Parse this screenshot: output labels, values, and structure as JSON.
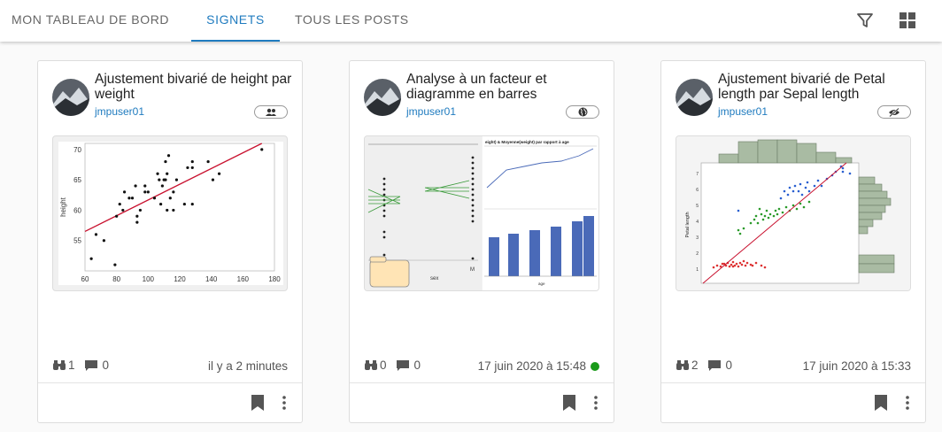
{
  "tabs": [
    {
      "label": "MON TABLEAU DE BORD"
    },
    {
      "label": "SIGNETS"
    },
    {
      "label": "TOUS LES POSTS"
    }
  ],
  "toolbar": {
    "filter_icon": "filter-icon",
    "grid_icon": "grid-view-icon"
  },
  "accent": "#1f7bbf",
  "cards": [
    {
      "title": "Ajustement bivarié de height par weight",
      "user": "jmpuser01",
      "visibility_icon": "group-icon",
      "views": "1",
      "comments": "0",
      "date": "il y a 2 minutes",
      "status_dot": false
    },
    {
      "title": "Analyse à un facteur et diagramme en barres",
      "user": "jmpuser01",
      "visibility_icon": "globe-icon",
      "views": "0",
      "comments": "0",
      "date": "17 juin 2020 à 15:48",
      "status_dot": true,
      "status_color": "#1a9a1a",
      "thumb_texts": {
        "sex_label": "sex",
        "m_label": "M",
        "age_label": "age",
        "chart_title": "eight) & Moyenne(weight) par rapport à age"
      }
    },
    {
      "title": "Ajustement bivarié de Petal length par Sepal length",
      "user": "jmpuser01",
      "visibility_icon": "eye-off-icon",
      "views": "2",
      "comments": "0",
      "date": "17 juin 2020 à 15:33",
      "status_dot": false,
      "thumb_texts": {
        "ylabel": "Petal length",
        "yticks": [
          "1",
          "2",
          "3",
          "4",
          "5",
          "6",
          "7"
        ]
      }
    }
  ],
  "chart_data": {
    "type": "scatter",
    "xlabel": "",
    "ylabel": "height",
    "xlim": [
      60,
      180
    ],
    "ylim": [
      50,
      71
    ],
    "xticks": [
      60,
      80,
      100,
      120,
      140,
      160,
      180
    ],
    "yticks": [
      55,
      60,
      65,
      70
    ],
    "points": [
      [
        64,
        52
      ],
      [
        67,
        56
      ],
      [
        72,
        55
      ],
      [
        79,
        51
      ],
      [
        80,
        59
      ],
      [
        82,
        61
      ],
      [
        84,
        60
      ],
      [
        85,
        63
      ],
      [
        88,
        62
      ],
      [
        90,
        62
      ],
      [
        92,
        64
      ],
      [
        93,
        59
      ],
      [
        93,
        58
      ],
      [
        95,
        60
      ],
      [
        98,
        63
      ],
      [
        98,
        64
      ],
      [
        100,
        63
      ],
      [
        104,
        62
      ],
      [
        106,
        66
      ],
      [
        107,
        65
      ],
      [
        108,
        61
      ],
      [
        109,
        64
      ],
      [
        110,
        65
      ],
      [
        111,
        68
      ],
      [
        111,
        65
      ],
      [
        112,
        66
      ],
      [
        112,
        60
      ],
      [
        113,
        69
      ],
      [
        114,
        62
      ],
      [
        116,
        60
      ],
      [
        116,
        63
      ],
      [
        118,
        65
      ],
      [
        123,
        61
      ],
      [
        125,
        67
      ],
      [
        128,
        61
      ],
      [
        128,
        67
      ],
      [
        128,
        68
      ],
      [
        138,
        68
      ],
      [
        141,
        65
      ],
      [
        145,
        66
      ],
      [
        172,
        70
      ]
    ],
    "fit_line": [
      [
        60,
        56.5
      ],
      [
        172,
        71
      ]
    ]
  }
}
